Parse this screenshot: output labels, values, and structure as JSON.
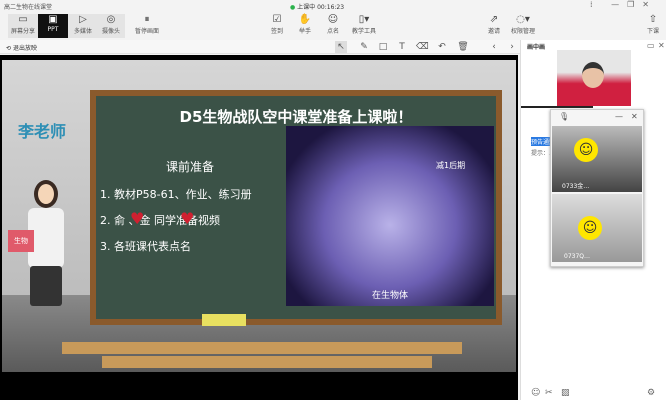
{
  "window": {
    "title": "高二生物在线课堂",
    "status": "上课中",
    "timer": "00:16:23"
  },
  "toolbar": {
    "items": [
      {
        "label": "屏幕分享",
        "icon": "screen-share-icon"
      },
      {
        "label": "PPT",
        "icon": "ppt-icon"
      },
      {
        "label": "多媒体",
        "icon": "media-icon"
      },
      {
        "label": "摄像头",
        "icon": "camera-icon"
      },
      {
        "label": "暂停画面",
        "icon": "pause-icon"
      }
    ],
    "center": [
      {
        "label": "签到",
        "icon": "checkin-icon"
      },
      {
        "label": "举手",
        "icon": "hand-icon"
      },
      {
        "label": "点名",
        "icon": "rollcall-icon"
      },
      {
        "label": "教学工具",
        "icon": "tools-icon"
      }
    ],
    "right": [
      {
        "label": "邀请",
        "icon": "invite-icon"
      },
      {
        "label": "权限管理",
        "icon": "permission-icon"
      },
      {
        "label": "下课",
        "icon": "end-class-icon"
      }
    ]
  },
  "subbar": {
    "exit_label": "退出放映"
  },
  "slide": {
    "teacher": "李老师",
    "title": "D5生物战队空中课堂准备上课啦！",
    "prep_title": "课前准备",
    "items": [
      "1. 教材P58-61、作业、练习册",
      "2. 俞    、金    同学准备视频",
      "3. 各班课代表点名"
    ],
    "image_labels": [
      "减1后期",
      "在生物体"
    ],
    "book": "生物"
  },
  "panel": {
    "title": "画中画",
    "hint_tag": "预告通知",
    "hint_text": "提示：…"
  },
  "videos": [
    {
      "label": "0733金…"
    },
    {
      "label": "0737Q…"
    }
  ]
}
